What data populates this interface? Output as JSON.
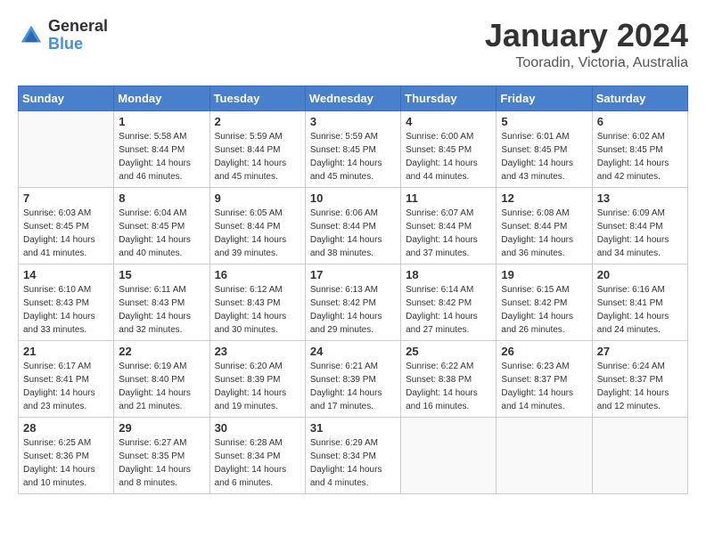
{
  "header": {
    "logo_general": "General",
    "logo_blue": "Blue",
    "month_year": "January 2024",
    "location": "Tooradin, Victoria, Australia"
  },
  "weekdays": [
    "Sunday",
    "Monday",
    "Tuesday",
    "Wednesday",
    "Thursday",
    "Friday",
    "Saturday"
  ],
  "weeks": [
    [
      {
        "day": "",
        "info": ""
      },
      {
        "day": "1",
        "info": "Sunrise: 5:58 AM\nSunset: 8:44 PM\nDaylight: 14 hours\nand 46 minutes."
      },
      {
        "day": "2",
        "info": "Sunrise: 5:59 AM\nSunset: 8:44 PM\nDaylight: 14 hours\nand 45 minutes."
      },
      {
        "day": "3",
        "info": "Sunrise: 5:59 AM\nSunset: 8:45 PM\nDaylight: 14 hours\nand 45 minutes."
      },
      {
        "day": "4",
        "info": "Sunrise: 6:00 AM\nSunset: 8:45 PM\nDaylight: 14 hours\nand 44 minutes."
      },
      {
        "day": "5",
        "info": "Sunrise: 6:01 AM\nSunset: 8:45 PM\nDaylight: 14 hours\nand 43 minutes."
      },
      {
        "day": "6",
        "info": "Sunrise: 6:02 AM\nSunset: 8:45 PM\nDaylight: 14 hours\nand 42 minutes."
      }
    ],
    [
      {
        "day": "7",
        "info": "Sunrise: 6:03 AM\nSunset: 8:45 PM\nDaylight: 14 hours\nand 41 minutes."
      },
      {
        "day": "8",
        "info": "Sunrise: 6:04 AM\nSunset: 8:45 PM\nDaylight: 14 hours\nand 40 minutes."
      },
      {
        "day": "9",
        "info": "Sunrise: 6:05 AM\nSunset: 8:44 PM\nDaylight: 14 hours\nand 39 minutes."
      },
      {
        "day": "10",
        "info": "Sunrise: 6:06 AM\nSunset: 8:44 PM\nDaylight: 14 hours\nand 38 minutes."
      },
      {
        "day": "11",
        "info": "Sunrise: 6:07 AM\nSunset: 8:44 PM\nDaylight: 14 hours\nand 37 minutes."
      },
      {
        "day": "12",
        "info": "Sunrise: 6:08 AM\nSunset: 8:44 PM\nDaylight: 14 hours\nand 36 minutes."
      },
      {
        "day": "13",
        "info": "Sunrise: 6:09 AM\nSunset: 8:44 PM\nDaylight: 14 hours\nand 34 minutes."
      }
    ],
    [
      {
        "day": "14",
        "info": "Sunrise: 6:10 AM\nSunset: 8:43 PM\nDaylight: 14 hours\nand 33 minutes."
      },
      {
        "day": "15",
        "info": "Sunrise: 6:11 AM\nSunset: 8:43 PM\nDaylight: 14 hours\nand 32 minutes."
      },
      {
        "day": "16",
        "info": "Sunrise: 6:12 AM\nSunset: 8:43 PM\nDaylight: 14 hours\nand 30 minutes."
      },
      {
        "day": "17",
        "info": "Sunrise: 6:13 AM\nSunset: 8:42 PM\nDaylight: 14 hours\nand 29 minutes."
      },
      {
        "day": "18",
        "info": "Sunrise: 6:14 AM\nSunset: 8:42 PM\nDaylight: 14 hours\nand 27 minutes."
      },
      {
        "day": "19",
        "info": "Sunrise: 6:15 AM\nSunset: 8:42 PM\nDaylight: 14 hours\nand 26 minutes."
      },
      {
        "day": "20",
        "info": "Sunrise: 6:16 AM\nSunset: 8:41 PM\nDaylight: 14 hours\nand 24 minutes."
      }
    ],
    [
      {
        "day": "21",
        "info": "Sunrise: 6:17 AM\nSunset: 8:41 PM\nDaylight: 14 hours\nand 23 minutes."
      },
      {
        "day": "22",
        "info": "Sunrise: 6:19 AM\nSunset: 8:40 PM\nDaylight: 14 hours\nand 21 minutes."
      },
      {
        "day": "23",
        "info": "Sunrise: 6:20 AM\nSunset: 8:39 PM\nDaylight: 14 hours\nand 19 minutes."
      },
      {
        "day": "24",
        "info": "Sunrise: 6:21 AM\nSunset: 8:39 PM\nDaylight: 14 hours\nand 17 minutes."
      },
      {
        "day": "25",
        "info": "Sunrise: 6:22 AM\nSunset: 8:38 PM\nDaylight: 14 hours\nand 16 minutes."
      },
      {
        "day": "26",
        "info": "Sunrise: 6:23 AM\nSunset: 8:37 PM\nDaylight: 14 hours\nand 14 minutes."
      },
      {
        "day": "27",
        "info": "Sunrise: 6:24 AM\nSunset: 8:37 PM\nDaylight: 14 hours\nand 12 minutes."
      }
    ],
    [
      {
        "day": "28",
        "info": "Sunrise: 6:25 AM\nSunset: 8:36 PM\nDaylight: 14 hours\nand 10 minutes."
      },
      {
        "day": "29",
        "info": "Sunrise: 6:27 AM\nSunset: 8:35 PM\nDaylight: 14 hours\nand 8 minutes."
      },
      {
        "day": "30",
        "info": "Sunrise: 6:28 AM\nSunset: 8:34 PM\nDaylight: 14 hours\nand 6 minutes."
      },
      {
        "day": "31",
        "info": "Sunrise: 6:29 AM\nSunset: 8:34 PM\nDaylight: 14 hours\nand 4 minutes."
      },
      {
        "day": "",
        "info": ""
      },
      {
        "day": "",
        "info": ""
      },
      {
        "day": "",
        "info": ""
      }
    ]
  ]
}
